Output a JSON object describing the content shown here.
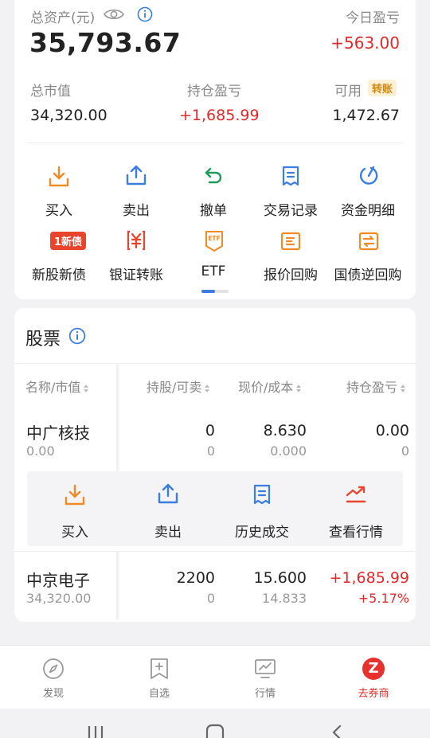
{
  "summary": {
    "total_label": "总资产(元)",
    "total_value": "35,793.67",
    "today_label": "今日盈亏",
    "today_value": "+563.00",
    "market_label": "总市值",
    "market_value": "34,320.00",
    "holding_label": "持仓盈亏",
    "holding_value": "+1,685.99",
    "avail_label": "可用",
    "transfer_badge": "转账",
    "avail_value": "1,472.67"
  },
  "actions": [
    {
      "label": "买入"
    },
    {
      "label": "卖出"
    },
    {
      "label": "撤单"
    },
    {
      "label": "交易记录"
    },
    {
      "label": "资金明细"
    },
    {
      "label": "新股新债",
      "badge": "1新债"
    },
    {
      "label": "银证转账"
    },
    {
      "label": "ETF",
      "icon_text": "ETF"
    },
    {
      "label": "报价回购"
    },
    {
      "label": "国债逆回购"
    }
  ],
  "stocks": {
    "title": "股票",
    "headers": [
      "名称/市值",
      "持股/可卖",
      "现价/成本",
      "持仓盈亏"
    ],
    "rows": [
      {
        "name": "中广核技",
        "mv": "0.00",
        "hold": "0",
        "sell": "0",
        "price": "8.630",
        "cost": "0.000",
        "pnl": "0.00",
        "pnl_pct": "0"
      },
      {
        "name": "中京电子",
        "mv": "34,320.00",
        "hold": "2200",
        "sell": "0",
        "price": "15.600",
        "cost": "14.833",
        "pnl": "+1,685.99",
        "pnl_pct": "+5.17%"
      }
    ],
    "row_actions": [
      "买入",
      "卖出",
      "历史成交",
      "查看行情"
    ]
  },
  "tabs": [
    {
      "label": "发现"
    },
    {
      "label": "自选"
    },
    {
      "label": "行情"
    },
    {
      "label": "去券商",
      "glyph": "Z"
    }
  ],
  "colors": {
    "accent": "#f08a24",
    "blue": "#3b7de0",
    "green": "#1f9a5b",
    "red": "#e02a2a"
  }
}
